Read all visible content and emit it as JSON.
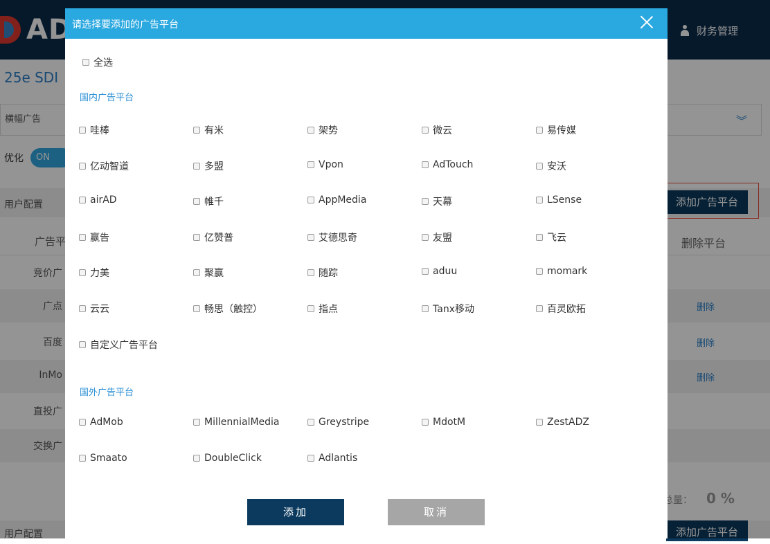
{
  "background": {
    "logo_text": "ADV",
    "finance_label": "财务管理",
    "app_name": "25e  SDI",
    "banner_label": "横幅广告",
    "optimization_label": "优化",
    "toggle_label": "ON",
    "user_config_label": "用户配置",
    "add_platform_button": "添加广告平台",
    "table_header_platform": "广告平",
    "table_header_delete": "删除平台",
    "rows": [
      {
        "name": "竞价广",
        "delete": ""
      },
      {
        "name": "广点",
        "delete": "删除"
      },
      {
        "name": "百度",
        "delete": "删除"
      },
      {
        "name": "InMo",
        "delete": "删除"
      },
      {
        "name": "直投广",
        "delete": ""
      },
      {
        "name": "交换广",
        "delete": ""
      }
    ],
    "ratio_label": "总量：",
    "ratio_value": "0 %",
    "user_config_label_2": "用户配置",
    "add_platform_button_2": "添加广告平台",
    "colors": {
      "topbar": "#0b2c4a",
      "accent": "#2aa8e0",
      "dark_button": "#0b3a5e",
      "highlight_border": "#e74c3c"
    }
  },
  "modal": {
    "title": "请选择要添加的广告平台",
    "select_all": "全选",
    "domestic_label": "国内广告平台",
    "domestic": [
      "哇棒",
      "有米",
      "架势",
      "微云",
      "易传媒",
      "亿动智道",
      "多盟",
      "Vpon",
      "AdTouch",
      "安沃",
      "airAD",
      "帷千",
      "AppMedia",
      "天幕",
      "LSense",
      "赢告",
      "亿赞普",
      "艾德思奇",
      "友盟",
      "飞云",
      "力美",
      "聚赢",
      "随踪",
      "aduu",
      "momark",
      "云云",
      "畅思（触控）",
      "指点",
      "Tanx移动",
      "百灵欧拓",
      "自定义广告平台"
    ],
    "foreign_label": "国外广告平台",
    "foreign": [
      "AdMob",
      "MillennialMedia",
      "Greystripe",
      "MdotM",
      "ZestADZ",
      "Smaato",
      "DoubleClick",
      "Adlantis"
    ],
    "add_button": "添加",
    "cancel_button": "取消",
    "close_icon": "close-icon",
    "colors": {
      "header": "#2aa8e0",
      "section_label": "#2a8fd6",
      "add": "#0b3a5e",
      "cancel": "#a6a6a6"
    }
  }
}
